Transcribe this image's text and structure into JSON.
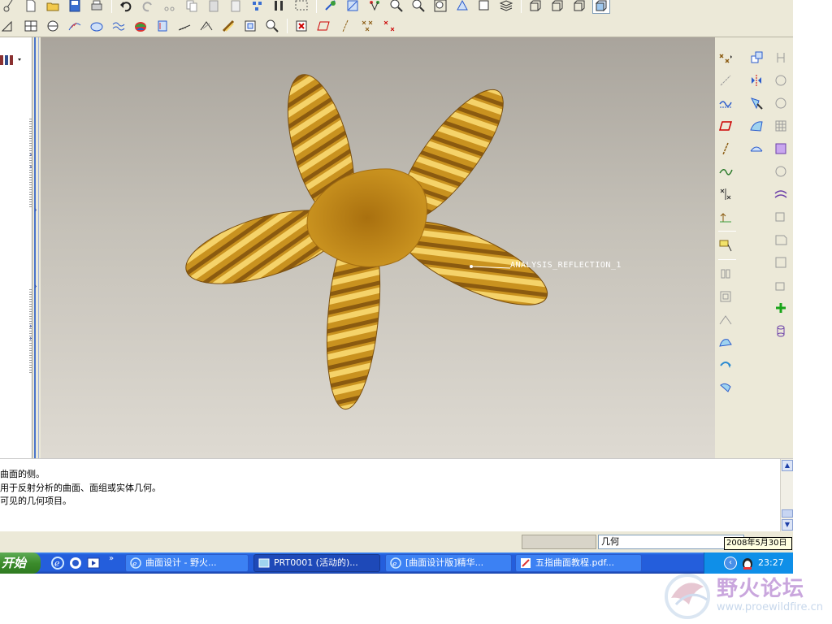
{
  "graphics": {
    "analysis_label": "ANALYSIS_REFLECTION_1"
  },
  "message_area": {
    "lines": [
      "曲面的侧。",
      "用于反射分析的曲面、面组或实体几何。",
      "可见的几何项目。"
    ]
  },
  "status_bar": {
    "selection_filter": "几何",
    "date_tooltip": "2008年5月30日"
  },
  "taskbar": {
    "start_label": "开始",
    "tasks": [
      {
        "label": "曲面设计 - 野火..."
      },
      {
        "label": "PRT0001 (活动的)..."
      },
      {
        "label": "[曲面设计版]精华..."
      },
      {
        "label": "五指曲面教程.pdf..."
      }
    ],
    "tray_time": "23:27"
  },
  "watermark": {
    "title": "野火论坛",
    "url": "www.proewildfire.cn"
  },
  "colors": {
    "star_fill": "#c9921f",
    "star_stripe_light": "#f5d36a",
    "star_stripe_dark": "#8a5a10",
    "taskbar_blue": "#245edc",
    "selection_rail": "#4a74c9"
  }
}
